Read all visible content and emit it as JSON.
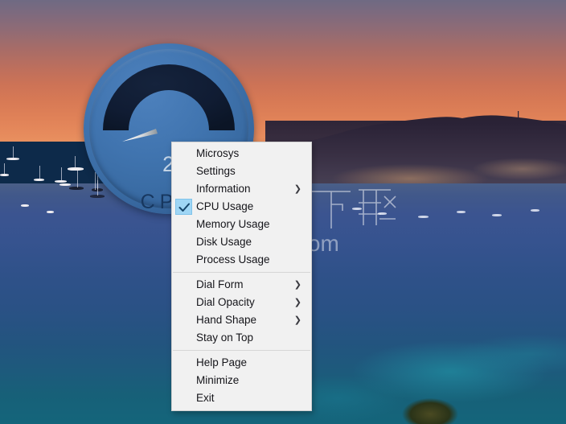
{
  "wallpaper": {
    "description": "sunset-bay-cityscape",
    "sky_top_color": "#6f6a83",
    "sky_horizon_color": "#e8905f",
    "sea_top_color": "#4a5f88",
    "sea_bottom_color": "#14657b"
  },
  "gauge": {
    "name": "cpu-usage-dial",
    "value": "2",
    "label": "CPU",
    "body_color": "#4074af",
    "face_color": "#101c33",
    "needle_color": "#e8e8e8",
    "value_text_color": "#c3d4e6",
    "label_text_color": "#17375f"
  },
  "watermark": {
    "site": "anxz.com",
    "cn_text": "下载"
  },
  "menu": {
    "name": "dial-context-menu",
    "accent_check_color": "#9fd6f5",
    "background_color": "#f1f1f1",
    "groups": [
      {
        "items": [
          {
            "label": "Microsys",
            "icon": "",
            "checked": false,
            "submenu": false,
            "disabled": false
          },
          {
            "label": "Settings",
            "icon": "",
            "checked": false,
            "submenu": false,
            "disabled": false
          },
          {
            "label": "Information",
            "icon": "chevron-right-icon",
            "checked": false,
            "submenu": true,
            "disabled": false
          },
          {
            "label": "CPU Usage",
            "icon": "check-icon",
            "checked": true,
            "submenu": false,
            "disabled": false
          },
          {
            "label": "Memory Usage",
            "icon": "",
            "checked": false,
            "submenu": false,
            "disabled": false
          },
          {
            "label": "Disk Usage",
            "icon": "",
            "checked": false,
            "submenu": false,
            "disabled": false
          },
          {
            "label": "Process Usage",
            "icon": "",
            "checked": false,
            "submenu": false,
            "disabled": false
          }
        ]
      },
      {
        "items": [
          {
            "label": "Dial Form",
            "icon": "chevron-right-icon",
            "checked": false,
            "submenu": true,
            "disabled": false
          },
          {
            "label": "Dial Opacity",
            "icon": "chevron-right-icon",
            "checked": false,
            "submenu": true,
            "disabled": false
          },
          {
            "label": "Hand Shape",
            "icon": "chevron-right-icon",
            "checked": false,
            "submenu": true,
            "disabled": false
          },
          {
            "label": "Stay on Top",
            "icon": "",
            "checked": false,
            "submenu": false,
            "disabled": false
          }
        ]
      },
      {
        "items": [
          {
            "label": "Help Page",
            "icon": "",
            "checked": false,
            "submenu": false,
            "disabled": false
          },
          {
            "label": "Minimize",
            "icon": "",
            "checked": false,
            "submenu": false,
            "disabled": false
          },
          {
            "label": "Exit",
            "icon": "",
            "checked": false,
            "submenu": false,
            "disabled": false
          }
        ]
      }
    ]
  }
}
